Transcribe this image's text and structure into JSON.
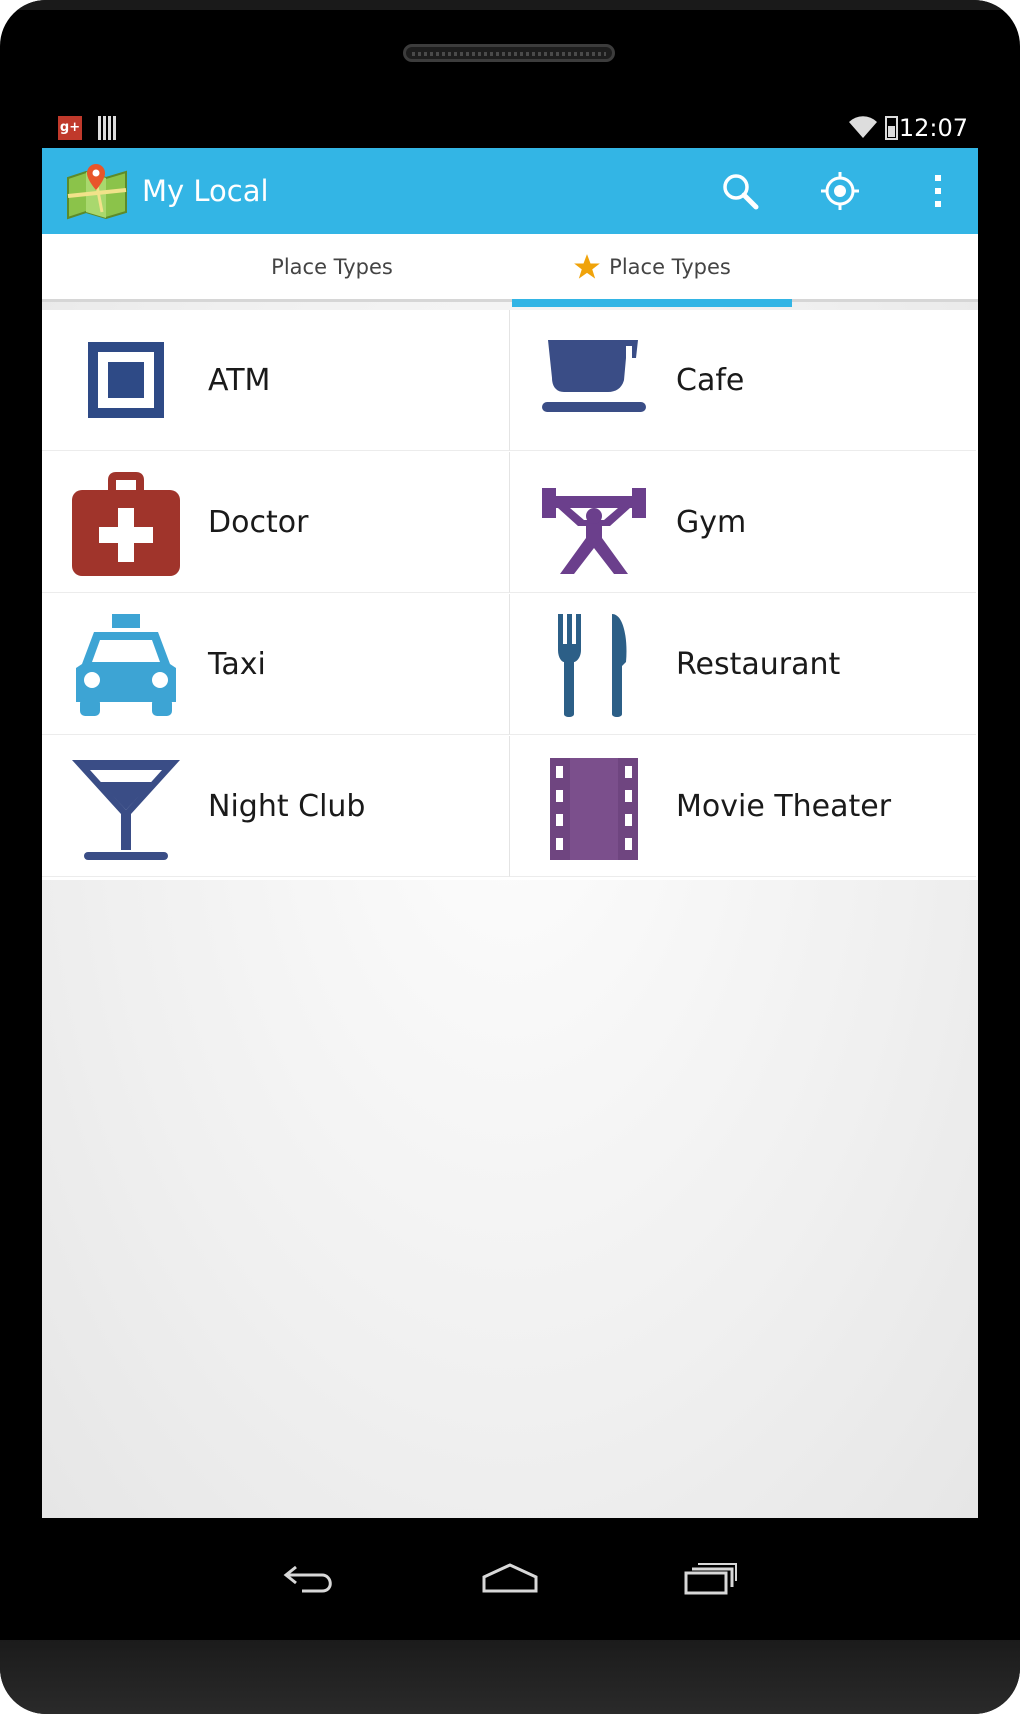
{
  "status_bar": {
    "time": "12:07",
    "icons": [
      "google-plus-icon",
      "sim-card-icon",
      "wifi-icon",
      "battery-icon"
    ]
  },
  "action_bar": {
    "title": "My Local",
    "app_icon": "map-pin-icon",
    "actions": [
      "search-icon",
      "my-location-icon",
      "overflow-menu-icon"
    ],
    "color": "#33b5e5"
  },
  "tabs": [
    {
      "label": "Place Types",
      "selected": false
    },
    {
      "label": "Place Types",
      "selected": true,
      "icon": "star-icon"
    }
  ],
  "place_types": [
    {
      "label": "ATM",
      "icon": "atm-icon",
      "color": "#2e4a86"
    },
    {
      "label": "Cafe",
      "icon": "cafe-icon",
      "color": "#3a4d86"
    },
    {
      "label": "Doctor",
      "icon": "doctor-icon",
      "color": "#a0342b"
    },
    {
      "label": "Gym",
      "icon": "gym-icon",
      "color": "#6b3f8c"
    },
    {
      "label": "Taxi",
      "icon": "taxi-icon",
      "color": "#3da4d4"
    },
    {
      "label": "Restaurant",
      "icon": "restaurant-icon",
      "color": "#2c5f87"
    },
    {
      "label": "Night Club",
      "icon": "cocktail-icon",
      "color": "#3a4d86"
    },
    {
      "label": "Movie Theater",
      "icon": "film-icon",
      "color": "#6f4580"
    }
  ],
  "nav_bar": [
    "back-icon",
    "home-icon",
    "recent-apps-icon"
  ]
}
